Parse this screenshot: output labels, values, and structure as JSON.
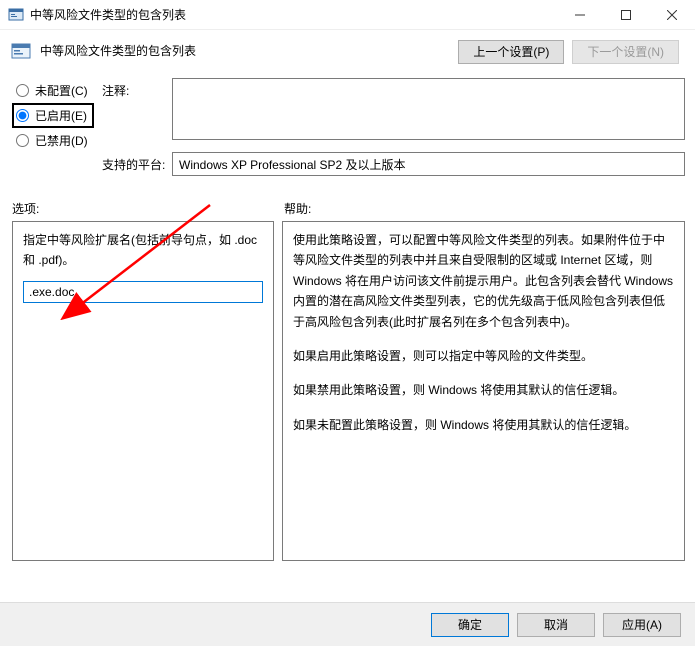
{
  "titlebar": {
    "title": "中等风险文件类型的包含列表"
  },
  "header": {
    "title": "中等风险文件类型的包含列表",
    "prev_btn": "上一个设置(P)",
    "next_btn": "下一个设置(N)"
  },
  "radios": {
    "not_configured": "未配置(C)",
    "enabled": "已启用(E)",
    "disabled": "已禁用(D)"
  },
  "fields": {
    "comment_label": "注释:",
    "comment_value": "",
    "platform_label": "支持的平台:",
    "platform_value": "Windows XP Professional SP2 及以上版本"
  },
  "section_labels": {
    "options": "选项:",
    "help": "帮助:"
  },
  "options": {
    "desc": "指定中等风险扩展名(包括前导句点，如 .doc 和 .pdf)。",
    "input_value": ".exe.doc"
  },
  "help": {
    "p1": "使用此策略设置，可以配置中等风险文件类型的列表。如果附件位于中等风险文件类型的列表中并且来自受限制的区域或 Internet 区域，则 Windows 将在用户访问该文件前提示用户。此包含列表会替代 Windows 内置的潜在高风险文件类型列表，它的优先级高于低风险包含列表但低于高风险包含列表(此时扩展名列在多个包含列表中)。",
    "p2": "如果启用此策略设置，则可以指定中等风险的文件类型。",
    "p3": "如果禁用此策略设置，则 Windows 将使用其默认的信任逻辑。",
    "p4": "如果未配置此策略设置，则 Windows 将使用其默认的信任逻辑。"
  },
  "footer": {
    "ok": "确定",
    "cancel": "取消",
    "apply": "应用(A)"
  }
}
